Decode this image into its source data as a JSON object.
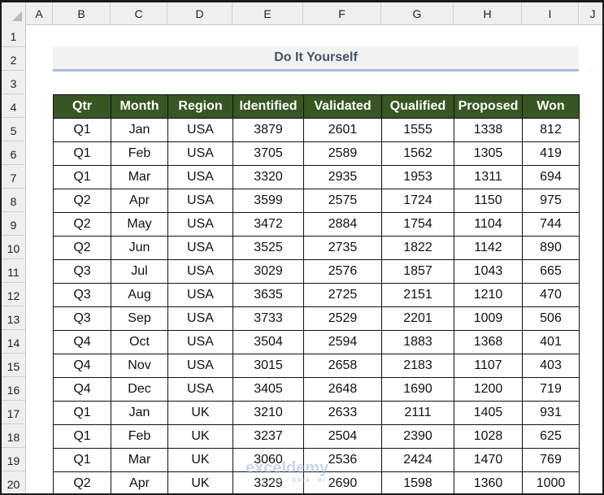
{
  "columns": [
    "A",
    "B",
    "C",
    "D",
    "E",
    "F",
    "G",
    "H",
    "I",
    "J"
  ],
  "rows": [
    "1",
    "2",
    "3",
    "4",
    "5",
    "6",
    "7",
    "8",
    "9",
    "10",
    "11",
    "12",
    "13",
    "14",
    "15",
    "16",
    "17",
    "18",
    "19",
    "20"
  ],
  "title": "Do It Yourself",
  "table": {
    "headers": [
      "Qtr",
      "Month",
      "Region",
      "Identified",
      "Validated",
      "Qualified",
      "Proposed",
      "Won"
    ],
    "rows": [
      [
        "Q1",
        "Jan",
        "USA",
        "3879",
        "2601",
        "1555",
        "1338",
        "812"
      ],
      [
        "Q1",
        "Feb",
        "USA",
        "3705",
        "2589",
        "1562",
        "1305",
        "419"
      ],
      [
        "Q1",
        "Mar",
        "USA",
        "3320",
        "2935",
        "1953",
        "1311",
        "694"
      ],
      [
        "Q2",
        "Apr",
        "USA",
        "3599",
        "2575",
        "1724",
        "1150",
        "975"
      ],
      [
        "Q2",
        "May",
        "USA",
        "3472",
        "2884",
        "1754",
        "1104",
        "744"
      ],
      [
        "Q2",
        "Jun",
        "USA",
        "3525",
        "2735",
        "1822",
        "1142",
        "890"
      ],
      [
        "Q3",
        "Jul",
        "USA",
        "3029",
        "2576",
        "1857",
        "1043",
        "665"
      ],
      [
        "Q3",
        "Aug",
        "USA",
        "3635",
        "2725",
        "2151",
        "1210",
        "470"
      ],
      [
        "Q3",
        "Sep",
        "USA",
        "3733",
        "2529",
        "2201",
        "1009",
        "506"
      ],
      [
        "Q4",
        "Oct",
        "USA",
        "3504",
        "2594",
        "1883",
        "1368",
        "401"
      ],
      [
        "Q4",
        "Nov",
        "USA",
        "3015",
        "2658",
        "2183",
        "1107",
        "403"
      ],
      [
        "Q4",
        "Dec",
        "USA",
        "3405",
        "2648",
        "1690",
        "1200",
        "719"
      ],
      [
        "Q1",
        "Jan",
        "UK",
        "3210",
        "2633",
        "2111",
        "1405",
        "931"
      ],
      [
        "Q1",
        "Feb",
        "UK",
        "3237",
        "2504",
        "2390",
        "1028",
        "625"
      ],
      [
        "Q1",
        "Mar",
        "UK",
        "3060",
        "2536",
        "2424",
        "1470",
        "769"
      ],
      [
        "Q2",
        "Apr",
        "UK",
        "3329",
        "2690",
        "1598",
        "1360",
        "1000"
      ]
    ]
  },
  "watermark": {
    "name": "exceldemy",
    "tagline": "EXCEL · DATA · BI"
  },
  "colors": {
    "header_bg": "#375623",
    "title_color": "#44546a",
    "title_underline": "#a9bde0"
  }
}
